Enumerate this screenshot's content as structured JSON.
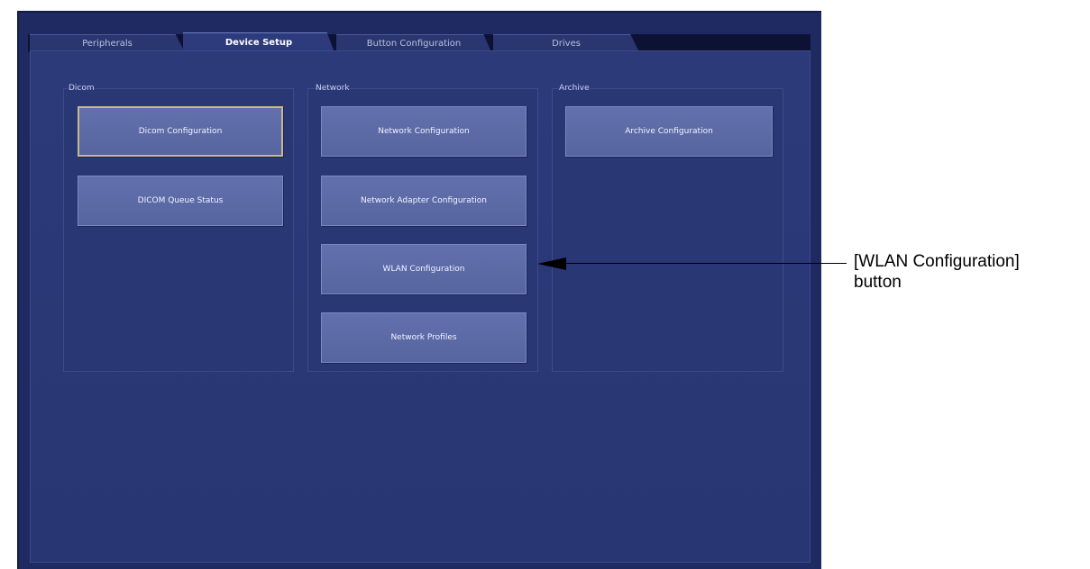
{
  "tabs": [
    {
      "label": "Peripherals",
      "active": false
    },
    {
      "label": "Device Setup",
      "active": true
    },
    {
      "label": "Button Configuration",
      "active": false
    },
    {
      "label": "Drives",
      "active": false
    }
  ],
  "groups": {
    "dicom": {
      "title": "Dicom",
      "buttons": [
        "Dicom Configuration",
        "DICOM Queue Status"
      ]
    },
    "network": {
      "title": "Network",
      "buttons": [
        "Network Configuration",
        "Network Adapter Configuration",
        "WLAN Configuration",
        "Network Profiles"
      ]
    },
    "archive": {
      "title": "Archive",
      "buttons": [
        "Archive Configuration"
      ]
    }
  },
  "callout": {
    "line1": "[WLAN Configuration]",
    "line2": "button"
  },
  "colors": {
    "background": "#1f2a62",
    "button": "#5c6aa7",
    "focus_border": "#c8b98a"
  }
}
